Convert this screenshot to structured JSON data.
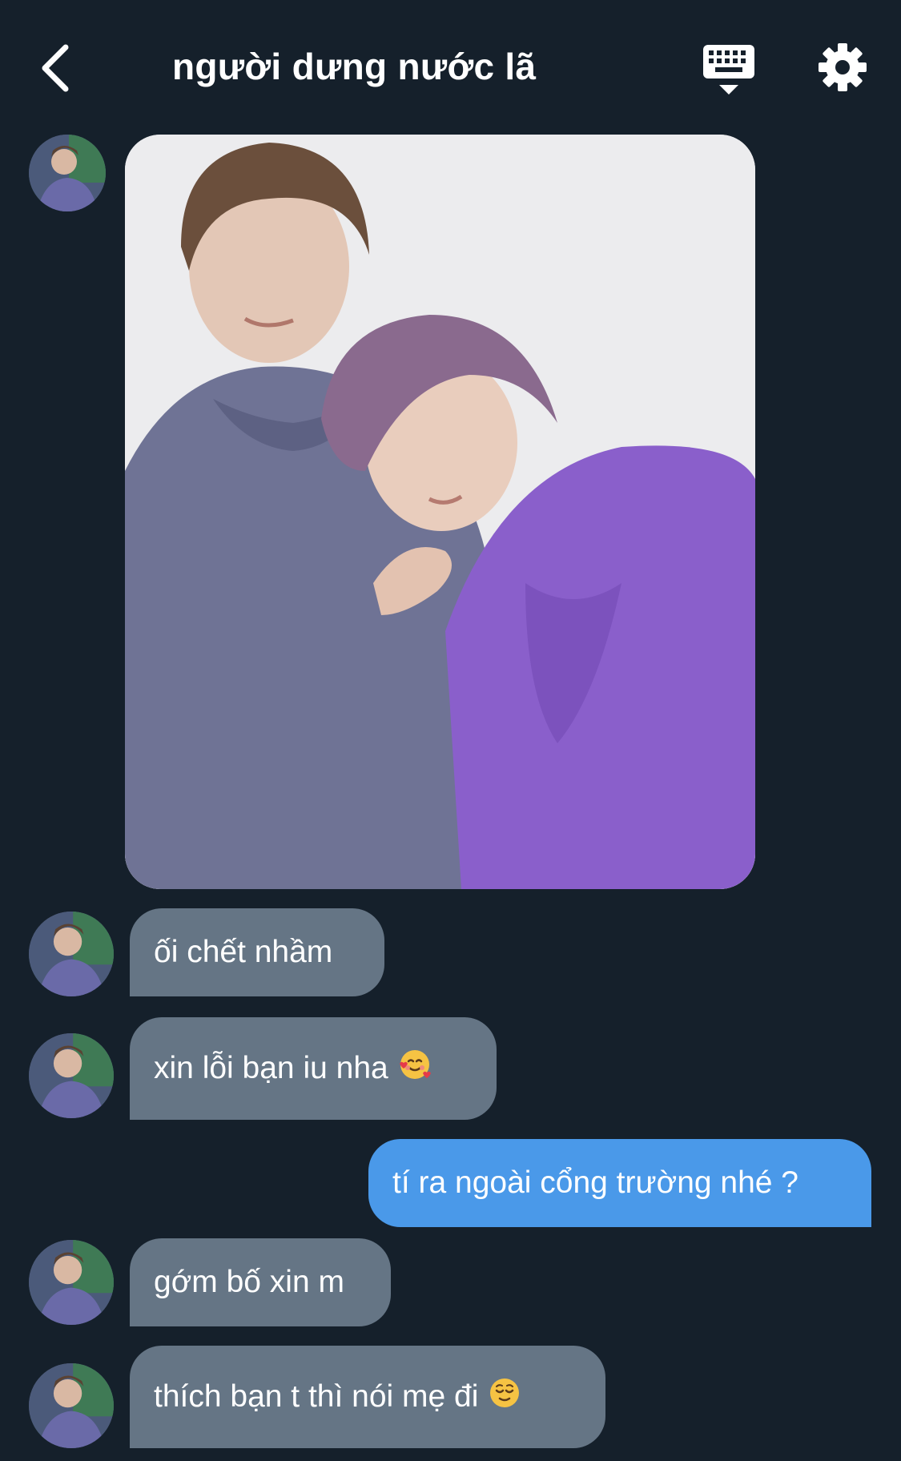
{
  "header": {
    "title": "người dưng nước lã",
    "icons": [
      "back-chevron-icon",
      "keyboard-icon",
      "gear-icon"
    ]
  },
  "messages": [
    {
      "type": "image",
      "sender": "other",
      "description_icon": "photo"
    },
    {
      "type": "text",
      "sender": "other",
      "text": "ối chết nhầm"
    },
    {
      "type": "text",
      "sender": "other",
      "text": "xin lỗi bạn iu nha",
      "emoji": "smiling-face-with-hearts-icon"
    },
    {
      "type": "text",
      "sender": "me",
      "text": "tí ra ngoài cổng trường nhé ?"
    },
    {
      "type": "text",
      "sender": "other",
      "text": "gớm bố xin m"
    },
    {
      "type": "text",
      "sender": "other",
      "text": "thích bạn t thì nói mẹ đi",
      "emoji": "relieved-face-icon"
    }
  ],
  "colors": {
    "background": "#15202b",
    "incoming_bubble": "#657585",
    "outgoing_bubble": "#4a99e9",
    "text": "#ffffff"
  }
}
